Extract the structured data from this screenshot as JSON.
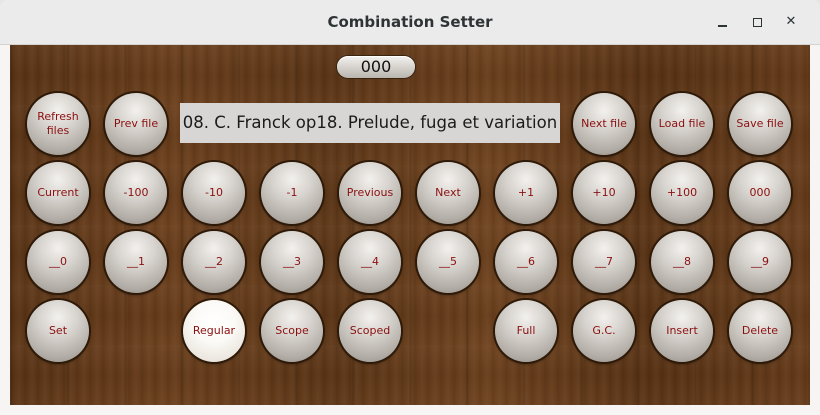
{
  "window": {
    "title": "Combination Setter"
  },
  "counter": "000",
  "display": "08. C. Franck op18. Prelude, fuga et variation",
  "rows": {
    "r1": {
      "refresh": "Refresh files",
      "prev_file": "Prev file",
      "next_file": "Next file",
      "load_file": "Load file",
      "save_file": "Save file"
    },
    "r2": [
      "Current",
      "-100",
      "-10",
      "-1",
      "Previous",
      "Next",
      "+1",
      "+10",
      "+100",
      "000"
    ],
    "r3": [
      "__0",
      "__1",
      "__2",
      "__3",
      "__4",
      "__5",
      "__6",
      "__7",
      "__8",
      "__9"
    ],
    "r4": {
      "set": "Set",
      "regular": "Regular",
      "scope": "Scope",
      "scoped": "Scoped",
      "full": "Full",
      "gc": "G.C.",
      "insert": "Insert",
      "delete": "Delete"
    }
  },
  "state": {
    "active_button": "Regular"
  }
}
